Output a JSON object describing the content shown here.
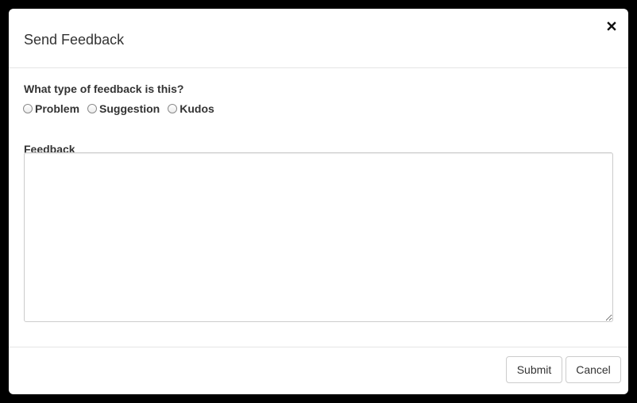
{
  "dialog": {
    "title": "Send Feedback",
    "close_icon": "close-icon"
  },
  "form": {
    "type_question": "What type of feedback is this?",
    "type_options": [
      "Problem",
      "Suggestion",
      "Kudos"
    ],
    "feedback_label": "Feedback",
    "feedback_value": "",
    "feedback_placeholder": ""
  },
  "footer": {
    "submit_label": "Submit",
    "cancel_label": "Cancel"
  }
}
